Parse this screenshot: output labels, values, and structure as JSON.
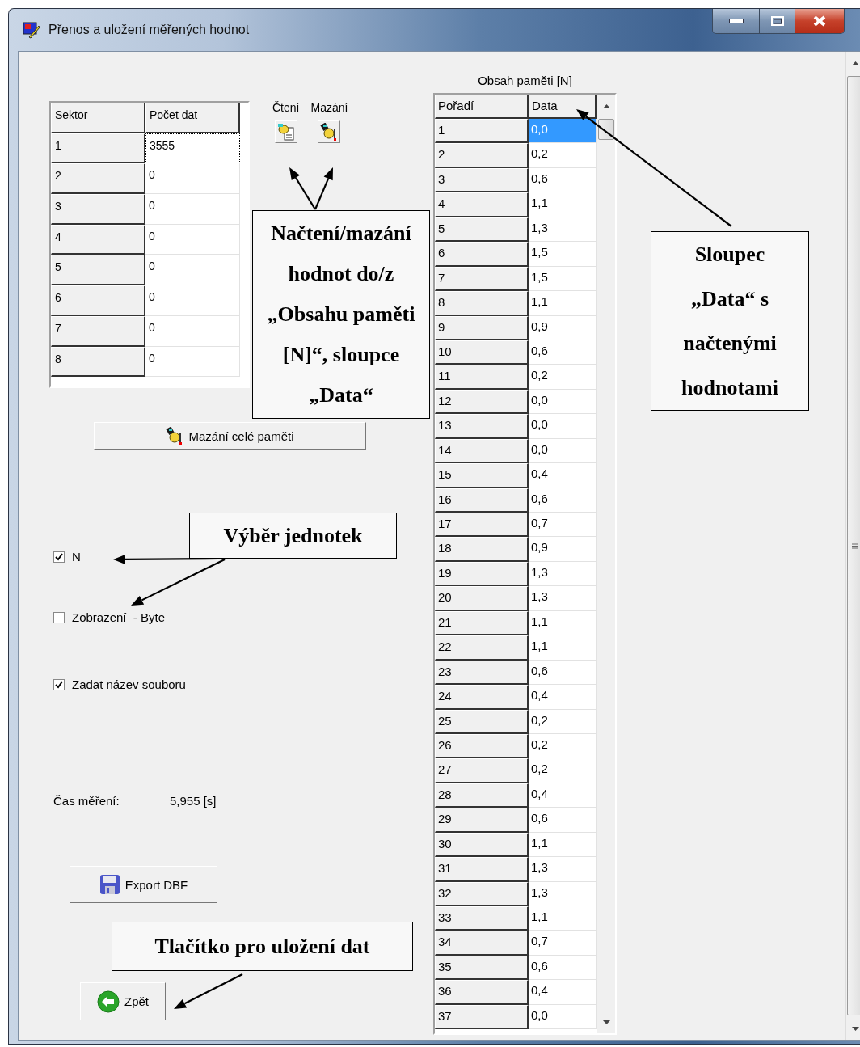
{
  "window": {
    "title": "Přenos a uložení měřených hodnot"
  },
  "sector_table": {
    "columns": [
      "Sektor",
      "Počet dat"
    ],
    "rows": [
      {
        "sector": "1",
        "count": "3555",
        "focused": true
      },
      {
        "sector": "2",
        "count": "0",
        "focused": false
      },
      {
        "sector": "3",
        "count": "0",
        "focused": false
      },
      {
        "sector": "4",
        "count": "0",
        "focused": false
      },
      {
        "sector": "5",
        "count": "0",
        "focused": false
      },
      {
        "sector": "6",
        "count": "0",
        "focused": false
      },
      {
        "sector": "7",
        "count": "0",
        "focused": false
      },
      {
        "sector": "8",
        "count": "0",
        "focused": false
      }
    ]
  },
  "action_buttons": [
    {
      "label": "Čtení",
      "kind": "read"
    },
    {
      "label": "Mazání",
      "kind": "erase"
    }
  ],
  "clear_memory_button": {
    "label": "Mazání celé paměti"
  },
  "checkboxes": [
    {
      "label": "N",
      "checked": true
    },
    {
      "label": "Zobrazení  - Byte",
      "checked": false
    },
    {
      "label": "Zadat název souboru",
      "checked": true
    }
  ],
  "measurement_time": {
    "label": "Čas měření:",
    "value": "5,955 [s]"
  },
  "export_button": {
    "label": "Export DBF"
  },
  "back_button": {
    "label": "Zpět"
  },
  "memory_table": {
    "title": "Obsah paměti [N]",
    "columns": [
      "Pořadí",
      "Data"
    ],
    "rows": [
      {
        "index": "1",
        "value": "0,0",
        "selected": true
      },
      {
        "index": "2",
        "value": "0,2",
        "selected": false
      },
      {
        "index": "3",
        "value": "0,6",
        "selected": false
      },
      {
        "index": "4",
        "value": "1,1",
        "selected": false
      },
      {
        "index": "5",
        "value": "1,3",
        "selected": false
      },
      {
        "index": "6",
        "value": "1,5",
        "selected": false
      },
      {
        "index": "7",
        "value": "1,5",
        "selected": false
      },
      {
        "index": "8",
        "value": "1,1",
        "selected": false
      },
      {
        "index": "9",
        "value": "0,9",
        "selected": false
      },
      {
        "index": "10",
        "value": "0,6",
        "selected": false
      },
      {
        "index": "11",
        "value": "0,2",
        "selected": false
      },
      {
        "index": "12",
        "value": "0,0",
        "selected": false
      },
      {
        "index": "13",
        "value": "0,0",
        "selected": false
      },
      {
        "index": "14",
        "value": "0,0",
        "selected": false
      },
      {
        "index": "15",
        "value": "0,4",
        "selected": false
      },
      {
        "index": "16",
        "value": "0,6",
        "selected": false
      },
      {
        "index": "17",
        "value": "0,7",
        "selected": false
      },
      {
        "index": "18",
        "value": "0,9",
        "selected": false
      },
      {
        "index": "19",
        "value": "1,3",
        "selected": false
      },
      {
        "index": "20",
        "value": "1,3",
        "selected": false
      },
      {
        "index": "21",
        "value": "1,1",
        "selected": false
      },
      {
        "index": "22",
        "value": "1,1",
        "selected": false
      },
      {
        "index": "23",
        "value": "0,6",
        "selected": false
      },
      {
        "index": "24",
        "value": "0,4",
        "selected": false
      },
      {
        "index": "25",
        "value": "0,2",
        "selected": false
      },
      {
        "index": "26",
        "value": "0,2",
        "selected": false
      },
      {
        "index": "27",
        "value": "0,2",
        "selected": false
      },
      {
        "index": "28",
        "value": "0,4",
        "selected": false
      },
      {
        "index": "29",
        "value": "0,6",
        "selected": false
      },
      {
        "index": "30",
        "value": "1,1",
        "selected": false
      },
      {
        "index": "31",
        "value": "1,3",
        "selected": false
      },
      {
        "index": "32",
        "value": "1,3",
        "selected": false
      },
      {
        "index": "33",
        "value": "1,1",
        "selected": false
      },
      {
        "index": "34",
        "value": "0,7",
        "selected": false
      },
      {
        "index": "35",
        "value": "0,6",
        "selected": false
      },
      {
        "index": "36",
        "value": "0,4",
        "selected": false
      },
      {
        "index": "37",
        "value": "0,0",
        "selected": false
      }
    ]
  },
  "callouts": [
    {
      "lines": [
        "Načtení/mazání",
        "hodnot do/z",
        "„Obsahu paměti",
        "[N]“, sloupce",
        "„Data“"
      ]
    },
    {
      "lines": [
        "Sloupec",
        "„Data“ s",
        "načtenými",
        "hodnotami"
      ]
    },
    {
      "lines": [
        "Výběr jednotek"
      ]
    },
    {
      "lines": [
        "Tlačítko pro uložení dat"
      ]
    }
  ]
}
